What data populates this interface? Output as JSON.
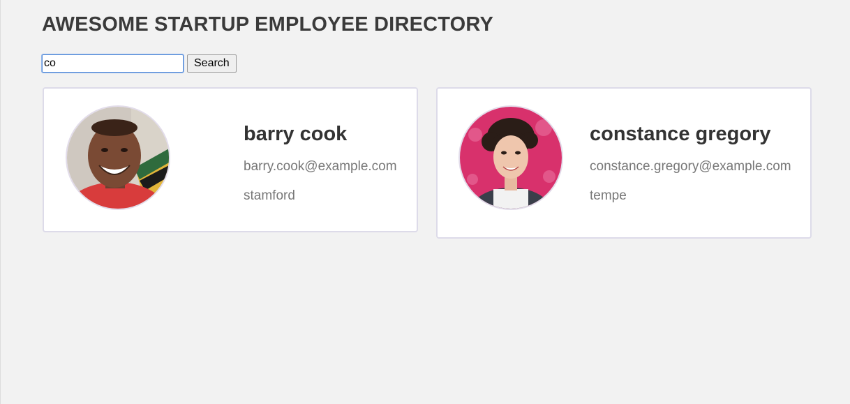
{
  "header": {
    "title": "AWESOME STARTUP EMPLOYEE DIRECTORY"
  },
  "search": {
    "value": "co",
    "button_label": "Search"
  },
  "employees": [
    {
      "name": "barry cook",
      "email": "barry.cook@example.com",
      "city": "stamford",
      "avatar_icon": "person-photo-icon"
    },
    {
      "name": "constance gregory",
      "email": "constance.gregory@example.com",
      "city": "tempe",
      "avatar_icon": "person-photo-icon"
    }
  ],
  "colors": {
    "background": "#f2f2f2",
    "card_border": "#dddbe9",
    "name_text": "#333333",
    "detail_text": "#777777",
    "input_focus": "#5b8fd8"
  }
}
